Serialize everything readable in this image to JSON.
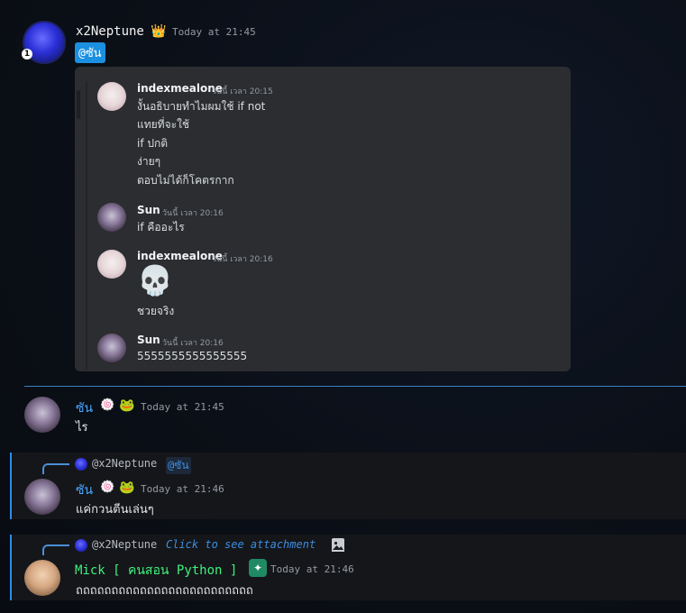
{
  "colors": {
    "accent": "#2f8be8",
    "mention_bg": "#1b8fe0",
    "mick_name": "#3ff27d",
    "sun_name": "#47a6ff"
  },
  "msg1": {
    "name": "x2Neptune",
    "crown": "👑",
    "time": "Today at 21:45",
    "badge_num": "1",
    "mention": "@ซัน",
    "embed": {
      "messages": [
        {
          "name": "indexmealone",
          "time": "วันนี้ เวลา 20:15",
          "lines": [
            "งั้นอธิบายทำไมผมใช้ if not",
            "แทยที่จะใช้",
            "if ปกติ",
            "ง่ายๆ",
            "ตอบไม่ได้ก็โคตรกาก"
          ]
        },
        {
          "name": "Sun",
          "time": "วันนี้ เวลา 20:16",
          "lines": [
            "if คืออะไร"
          ]
        },
        {
          "name": "indexmealone",
          "time": "วันนี้ เวลา 20:16",
          "lines": [
            "ชวยจริง"
          ],
          "emoji": "💀"
        },
        {
          "name": "Sun",
          "time": "วันนี้ เวลา 20:16",
          "lines": [
            "5555555555555555"
          ]
        }
      ]
    }
  },
  "msg2": {
    "name": "ซัน",
    "icon_a": "🍥",
    "icon_b": "🐸",
    "time": "Today at 21:45",
    "text": "ไร"
  },
  "msg3": {
    "reply_name": "@x2Neptune",
    "reply_mention": "@ซัน",
    "name": "ซัน",
    "icon_a": "🍥",
    "icon_b": "🐸",
    "time": "Today at 21:46",
    "text": "แค่กวนตีนเล่นๆ"
  },
  "msg4": {
    "reply_name": "@x2Neptune",
    "reply_attach": "Click to see attachment",
    "name": "Mick [ คนสอน Python ]",
    "badge": "✦",
    "time": "Today at 21:46",
    "text": "ถถถถถถถถถถถถถถถถถถถถถถถถถ"
  }
}
